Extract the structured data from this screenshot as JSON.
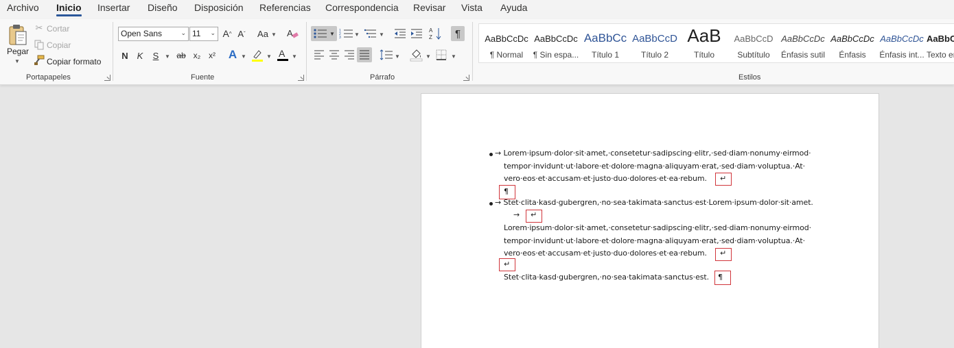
{
  "menu": {
    "tabs": [
      "Archivo",
      "Inicio",
      "Insertar",
      "Diseño",
      "Disposición",
      "Referencias",
      "Correspondencia",
      "Revisar",
      "Vista",
      "Ayuda"
    ],
    "active": "Inicio"
  },
  "clipboard": {
    "paste_label": "Pegar",
    "cut_label": "Cortar",
    "copy_label": "Copiar",
    "format_painter_label": "Copiar formato",
    "group_label": "Portapapeles"
  },
  "font": {
    "font_name": "Open Sans",
    "font_size": "11",
    "bold": "N",
    "italic": "K",
    "underline": "S",
    "strike": "ab",
    "subscript": "x₂",
    "superscript": "x²",
    "change_case": "Aa",
    "group_label": "Fuente"
  },
  "paragraph": {
    "group_label": "Párrafo",
    "pilcrow": "¶"
  },
  "styles": {
    "group_label": "Estilos",
    "items": [
      {
        "sample": "AaBbCcDc",
        "name": "¶ Normal"
      },
      {
        "sample": "AaBbCcDc",
        "name": "¶ Sin espa..."
      },
      {
        "sample": "AaBbCc",
        "name": "Título 1"
      },
      {
        "sample": "AaBbCcD",
        "name": "Título 2"
      },
      {
        "sample": "AaB",
        "name": "Título"
      },
      {
        "sample": "AaBbCcD",
        "name": "Subtítulo"
      },
      {
        "sample": "AaBbCcDc",
        "name": "Énfasis sutil"
      },
      {
        "sample": "AaBbCcDc",
        "name": "Énfasis"
      },
      {
        "sample": "AaBbCcDc",
        "name": "Énfasis int..."
      },
      {
        "sample": "AaBbCcDc",
        "name": "Texto en"
      }
    ]
  },
  "document": {
    "bullet1": {
      "line1": "→ Lorem·ipsum·dolor·sit·amet,·consetetur·sadipscing·elitr,·sed·diam·nonumy·eirmod·",
      "line2": "tempor·invidunt·ut·labore·et·dolore·magna·aliquyam·erat,·sed·diam·voluptua.·At·",
      "line3": "vero·eos·et·accusam·et·justo·duo·dolores·et·ea·rebum.",
      "line_break": "↵",
      "pilcrow": "¶"
    },
    "bullet2": {
      "line1": "→ Stet·clita·kasd·gubergren,·no·sea·takimata·sanctus·est·Lorem·ipsum·dolor·sit·amet.",
      "tab_arrow": "→",
      "line_break": "↵",
      "line2": "Lorem·ipsum·dolor·sit·amet,·consetetur·sadipscing·elitr,·sed·diam·nonumy·eirmod·",
      "line3": "tempor·invidunt·ut·labore·et·dolore·magna·aliquyam·erat,·sed·diam·voluptua.·At·",
      "line4": "vero·eos·et·accusam·et·justo·duo·dolores·et·ea·rebum.",
      "line_break2": "↵",
      "line_break3": "↵",
      "line5": "Stet·clita·kasd·gubergren,·no·sea·takimata·sanctus·est.",
      "pilcrow": "¶"
    }
  },
  "colors": {
    "accent": "#2b579a",
    "highlight_mark": "#d0343a",
    "highlight_yellow": "#ffff00",
    "font_color_bar": "#000000"
  }
}
